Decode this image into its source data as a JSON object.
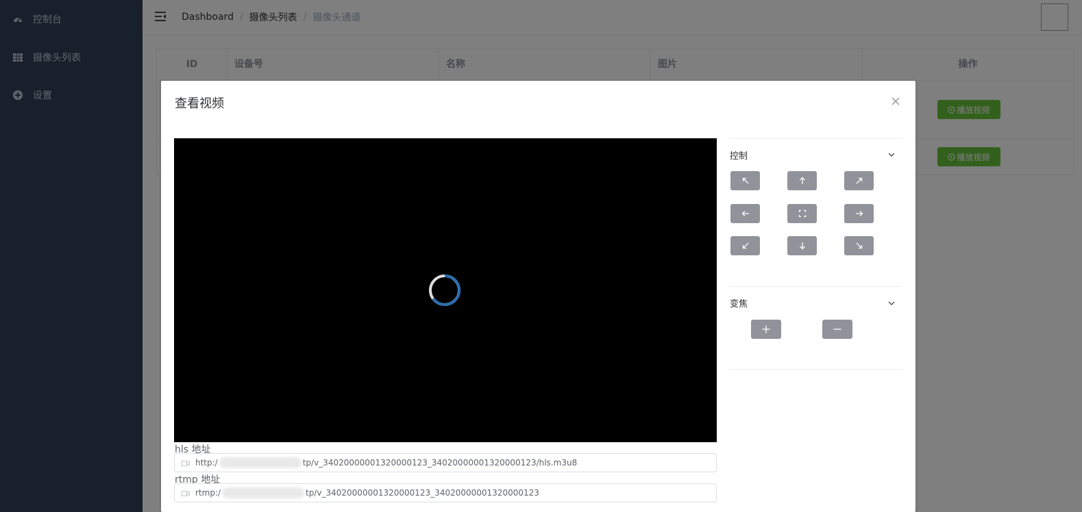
{
  "sidebar": {
    "items": [
      {
        "label": "控制台",
        "icon": "dashboard-icon"
      },
      {
        "label": "摄像头列表",
        "icon": "table-icon"
      },
      {
        "label": "设置",
        "icon": "settings-icon"
      }
    ]
  },
  "breadcrumb": [
    "Dashboard",
    "摄像头列表",
    "摄像头通道"
  ],
  "table": {
    "headers": [
      "ID",
      "设备号",
      "名称",
      "图片",
      "操作"
    ],
    "play_label": "播放视频"
  },
  "dialog": {
    "title": "查看视频",
    "hls_label": "hls 地址",
    "hls_prefix": "http:/",
    "hls_suffix": "tp/v_34020000001320000123_34020000001320000123/hls.m3u8",
    "rtmp_label": "rtmp 地址",
    "rtmp_prefix": "rtmp:/",
    "rtmp_suffix": "tp/v_34020000001320000123_34020000001320000123",
    "control_title": "控制",
    "zoom_title": "变焦"
  },
  "colors": {
    "sidebar": "#304156",
    "play_button": "#67c23a",
    "ptz_button": "#909399"
  }
}
